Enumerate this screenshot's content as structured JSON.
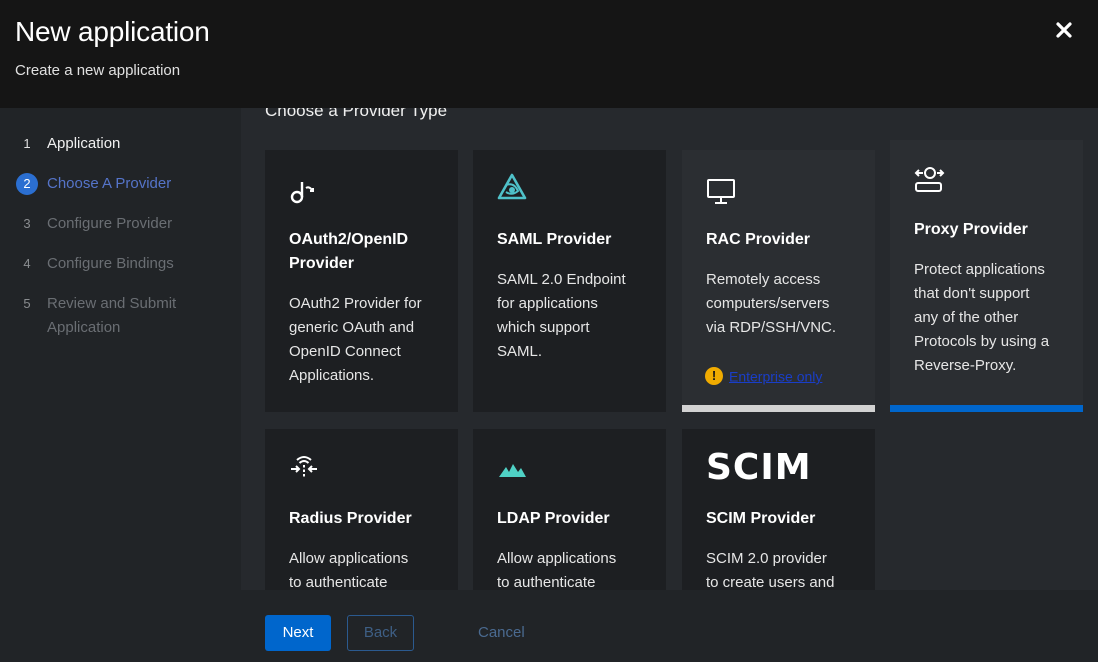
{
  "dialog": {
    "title": "New application",
    "subtitle": "Create a new application",
    "close_icon": "close-icon"
  },
  "steps": [
    {
      "num": "1",
      "label": "Application",
      "state": "done"
    },
    {
      "num": "2",
      "label": "Choose A Provider",
      "state": "active"
    },
    {
      "num": "3",
      "label": "Configure Provider",
      "state": "pending"
    },
    {
      "num": "4",
      "label": "Configure Bindings",
      "state": "pending"
    },
    {
      "num": "5",
      "label_line1": "Review and Submit",
      "label_line2": "Application",
      "state": "pending"
    }
  ],
  "main": {
    "section_title": "Choose a Provider Type",
    "cards": [
      {
        "title_line1": "OAuth2/OpenID",
        "title_line2": "Provider",
        "desc": [
          "OAuth2 Provider for",
          "generic OAuth and",
          "OpenID Connect",
          "Applications."
        ],
        "icon": "oauth-icon"
      },
      {
        "title": "SAML Provider",
        "desc": [
          "SAML 2.0 Endpoint",
          "for applications",
          "which support",
          "SAML."
        ],
        "icon": "saml-icon"
      },
      {
        "title": "RAC Provider",
        "desc": [
          "Remotely access",
          "computers/servers",
          "via RDP/SSH/VNC."
        ],
        "icon": "monitor-icon",
        "enterprise_label": "Enterprise only",
        "disabled": true
      },
      {
        "title": "Proxy Provider",
        "desc": [
          "Protect applications",
          "that don't support",
          "any of the other",
          "Protocols by using a",
          "Reverse-Proxy."
        ],
        "icon": "proxy-icon",
        "selected": true
      },
      {
        "title": "Radius Provider",
        "desc": [
          "Allow applications",
          "to authenticate"
        ],
        "icon": "radius-icon"
      },
      {
        "title": "LDAP Provider",
        "desc": [
          "Allow applications",
          "to authenticate"
        ],
        "icon": "ldap-icon"
      },
      {
        "title": "SCIM Provider",
        "desc": [
          "SCIM 2.0 provider",
          "to create users and"
        ],
        "icon_text": "SCIM"
      }
    ]
  },
  "footer": {
    "next_label": "Next",
    "back_label": "Back",
    "cancel_label": "Cancel"
  },
  "colors": {
    "accent": "#0066cc",
    "active_step": "#2b6fd1",
    "warning": "#f0ab00",
    "saml_teal": "#4fc1c9",
    "ldap_teal": "#4fd1c5"
  }
}
